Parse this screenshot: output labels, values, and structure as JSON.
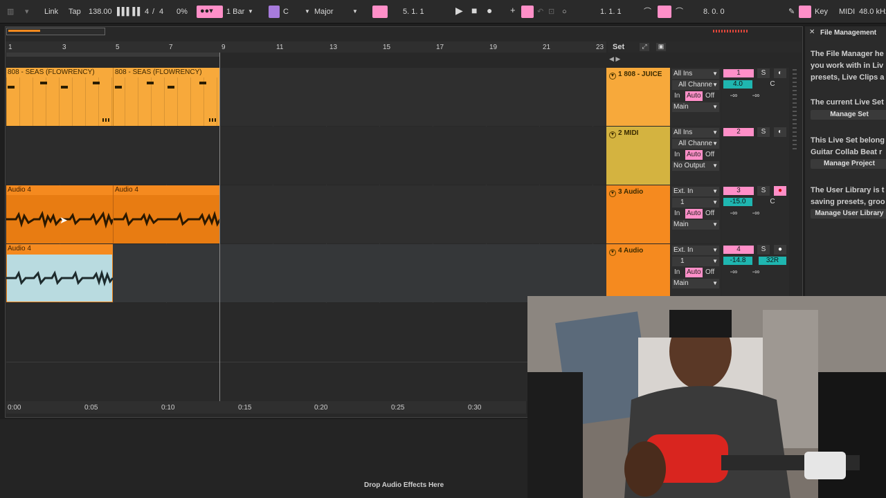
{
  "transport": {
    "link": "Link",
    "tap": "Tap",
    "tempo": "138.00",
    "time_sig_num": "4",
    "time_sig_slash": "/",
    "time_sig_den": "4",
    "groove": "0%",
    "quantize": "1 Bar",
    "key_root": "C",
    "scale": "Major",
    "position": "5.   1.   1",
    "loop_start": "1.   1.   1",
    "loop_length": "8.   0.   0",
    "key_label": "Key",
    "midi_label": "MIDI",
    "sample_rate": "48.0 kHz"
  },
  "ruler": {
    "bars": [
      "1",
      "3",
      "5",
      "7",
      "9",
      "11",
      "13",
      "15",
      "17",
      "19",
      "21",
      "23"
    ],
    "times": [
      "0:00",
      "0:05",
      "0:10",
      "0:15",
      "0:20",
      "0:25",
      "0:30"
    ]
  },
  "set_label": "Set",
  "clips": {
    "c1": "808 - SEAS (FLOWRENCY)",
    "c2": "808 - SEAS (FLOWRENCY)",
    "c3": "Audio 4",
    "c4": "Audio 4",
    "c5": "Audio 4"
  },
  "tracks": [
    {
      "name": "1 808 - JUICE",
      "color": "#f7a93b",
      "input": "All Ins",
      "channel": "All Channe",
      "monitor_in": "In",
      "monitor_auto": "Auto",
      "monitor_off": "Off",
      "output": "Main",
      "number": "1",
      "volume": "4.0",
      "pan": "C",
      "send_a": "-∞",
      "send_b": "-∞",
      "solo": "S"
    },
    {
      "name": "2 MIDI",
      "color": "#d4b340",
      "input": "All Ins",
      "channel": "All Channe",
      "monitor_in": "In",
      "monitor_auto": "Auto",
      "monitor_off": "Off",
      "output": "No Output",
      "number": "2",
      "solo": "S"
    },
    {
      "name": "3 Audio",
      "color": "#f58a1f",
      "input": "Ext. In",
      "channel": "1",
      "monitor_in": "In",
      "monitor_auto": "Auto",
      "monitor_off": "Off",
      "output": "Main",
      "number": "3",
      "volume": "-15.0",
      "pan": "C",
      "send_a": "-∞",
      "send_b": "-∞",
      "solo": "S"
    },
    {
      "name": "4 Audio",
      "color": "#f58a1f",
      "input": "Ext. In",
      "channel": "1",
      "monitor_in": "In",
      "monitor_auto": "Auto",
      "monitor_off": "Off",
      "output": "Main",
      "number": "4",
      "volume": "-14.8",
      "pan": "32R",
      "send_a": "-∞",
      "send_b": "-∞",
      "solo": "S"
    }
  ],
  "info_panel": {
    "title": "File Management",
    "p1_line1": "The File Manager he",
    "p1_line2": "you work with in Liv",
    "p1_line3": "presets, Live Clips a",
    "p2": "The current Live Set",
    "btn_set": "Manage Set",
    "p3_line1": "This Live Set belong",
    "p3_line2": "Guitar Collab Beat r",
    "btn_project": "Manage Project",
    "p4_line1": "The User Library is t",
    "p4_line2": "saving presets, groo",
    "btn_library": "Manage User Library"
  },
  "device_drop": "Drop Audio Effects Here"
}
